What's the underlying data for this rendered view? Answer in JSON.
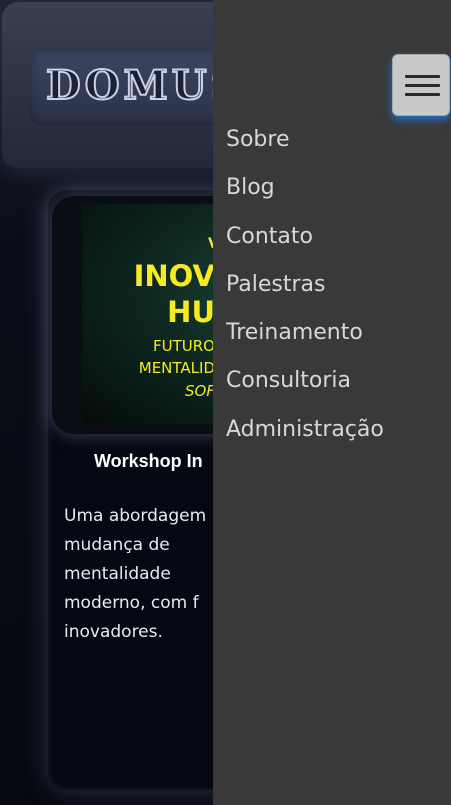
{
  "header": {
    "logo_text": "DOMUS"
  },
  "banner": {
    "line_small": "V",
    "line_big_1": "INOV",
    "line_big_2": "HU",
    "line_mid_1": "FUTURO",
    "line_mid_2": "MENTALID",
    "line_italic": "SOF"
  },
  "card": {
    "title": "Workshop In",
    "description_lines": [
      "Uma abordagem",
      "mudança   de",
      "mentalidade",
      "moderno, com f",
      "inovadores."
    ]
  },
  "drawer": {
    "items": [
      {
        "label": "Sobre"
      },
      {
        "label": "Blog"
      },
      {
        "label": "Contato"
      },
      {
        "label": "Palestras"
      },
      {
        "label": "Treinamento"
      },
      {
        "label": "Consultoria"
      },
      {
        "label": "Administração"
      }
    ]
  },
  "colors": {
    "drawer_bg": "#393939",
    "accent_yellow": "#f7ea22",
    "toggle_glow": "#1e78e6"
  }
}
